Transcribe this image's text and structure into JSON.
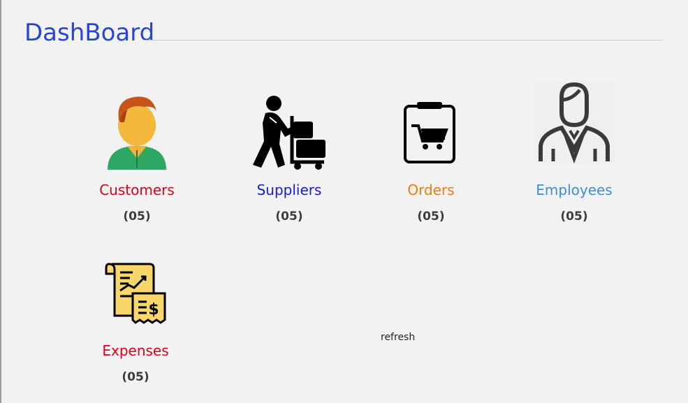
{
  "page": {
    "title": "DashBoard"
  },
  "tiles": [
    {
      "label": "Customers",
      "count": "(05)",
      "color": "#e0001b",
      "icon": "customer-icon"
    },
    {
      "label": "Suppliers",
      "count": "(05)",
      "color": "#1a1adf",
      "icon": "supplier-icon"
    },
    {
      "label": "Orders",
      "count": "(05)",
      "color": "#ef7d0a",
      "icon": "orders-icon"
    },
    {
      "label": "Employees",
      "count": "(05)",
      "color": "#3b8fd9",
      "icon": "employee-icon"
    },
    {
      "label": "Expenses",
      "count": "(05)",
      "color": "#e0001b",
      "icon": "expenses-icon"
    }
  ],
  "actions": {
    "refresh_label": "refresh"
  }
}
